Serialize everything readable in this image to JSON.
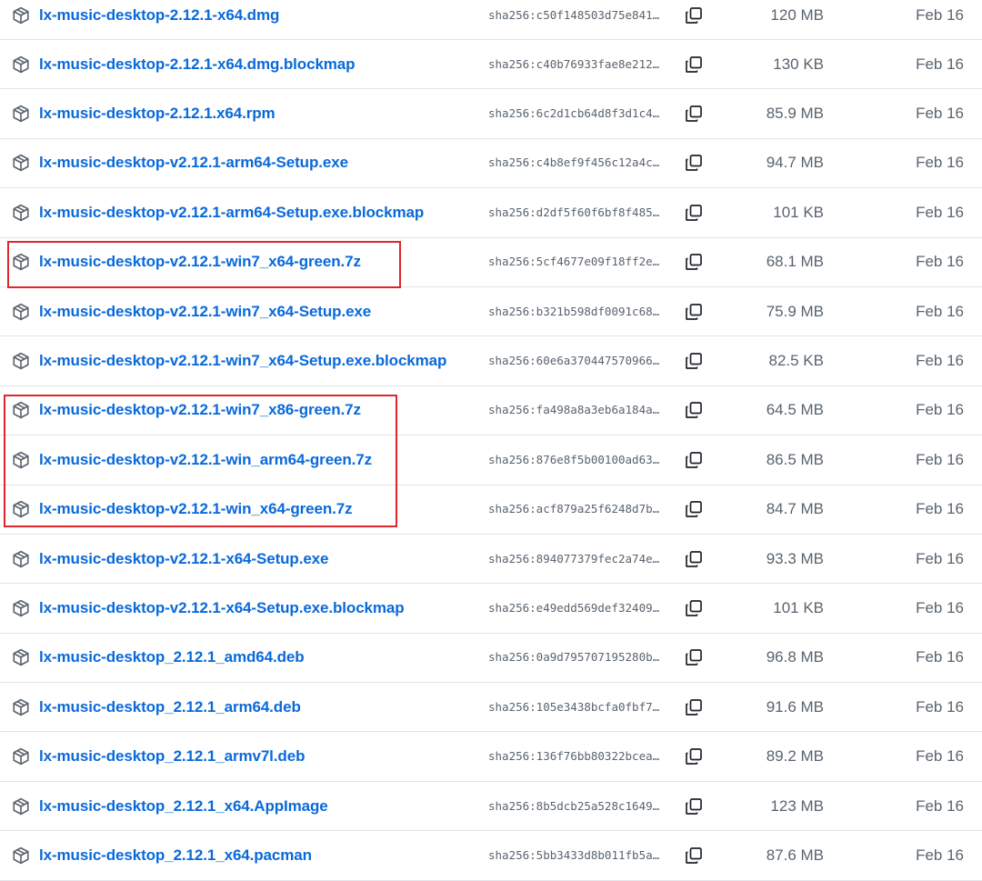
{
  "icons": {
    "package": "package-icon",
    "copy": "copy-icon"
  },
  "colors": {
    "link": "#0969da",
    "muted": "#59636e",
    "border": "#e1e4e8",
    "highlight": "#e0262d"
  },
  "assets": [
    {
      "name": "lx-music-desktop-2.12.1-x64.dmg",
      "sha": "sha256:c50f148503d75e841…",
      "size": "120 MB",
      "date": "Feb 16"
    },
    {
      "name": "lx-music-desktop-2.12.1-x64.dmg.blockmap",
      "sha": "sha256:c40b76933fae8e212…",
      "size": "130 KB",
      "date": "Feb 16"
    },
    {
      "name": "lx-music-desktop-2.12.1.x64.rpm",
      "sha": "sha256:6c2d1cb64d8f3d1c4…",
      "size": "85.9 MB",
      "date": "Feb 16"
    },
    {
      "name": "lx-music-desktop-v2.12.1-arm64-Setup.exe",
      "sha": "sha256:c4b8ef9f456c12a4c…",
      "size": "94.7 MB",
      "date": "Feb 16"
    },
    {
      "name": "lx-music-desktop-v2.12.1-arm64-Setup.exe.blockmap",
      "sha": "sha256:d2df5f60f6bf8f485…",
      "size": "101 KB",
      "date": "Feb 16"
    },
    {
      "name": "lx-music-desktop-v2.12.1-win7_x64-green.7z",
      "sha": "sha256:5cf4677e09f18ff2e…",
      "size": "68.1 MB",
      "date": "Feb 16"
    },
    {
      "name": "lx-music-desktop-v2.12.1-win7_x64-Setup.exe",
      "sha": "sha256:b321b598df0091c68…",
      "size": "75.9 MB",
      "date": "Feb 16"
    },
    {
      "name": "lx-music-desktop-v2.12.1-win7_x64-Setup.exe.blockmap",
      "sha": "sha256:60e6a370447570966…",
      "size": "82.5 KB",
      "date": "Feb 16"
    },
    {
      "name": "lx-music-desktop-v2.12.1-win7_x86-green.7z",
      "sha": "sha256:fa498a8a3eb6a184a…",
      "size": "64.5 MB",
      "date": "Feb 16"
    },
    {
      "name": "lx-music-desktop-v2.12.1-win_arm64-green.7z",
      "sha": "sha256:876e8f5b00100ad63…",
      "size": "86.5 MB",
      "date": "Feb 16"
    },
    {
      "name": "lx-music-desktop-v2.12.1-win_x64-green.7z",
      "sha": "sha256:acf879a25f6248d7b…",
      "size": "84.7 MB",
      "date": "Feb 16"
    },
    {
      "name": "lx-music-desktop-v2.12.1-x64-Setup.exe",
      "sha": "sha256:894077379fec2a74e…",
      "size": "93.3 MB",
      "date": "Feb 16"
    },
    {
      "name": "lx-music-desktop-v2.12.1-x64-Setup.exe.blockmap",
      "sha": "sha256:e49edd569def32409…",
      "size": "101 KB",
      "date": "Feb 16"
    },
    {
      "name": "lx-music-desktop_2.12.1_amd64.deb",
      "sha": "sha256:0a9d795707195280b…",
      "size": "96.8 MB",
      "date": "Feb 16"
    },
    {
      "name": "lx-music-desktop_2.12.1_arm64.deb",
      "sha": "sha256:105e3438bcfa0fbf7…",
      "size": "91.6 MB",
      "date": "Feb 16"
    },
    {
      "name": "lx-music-desktop_2.12.1_armv7l.deb",
      "sha": "sha256:136f76bb80322bcea…",
      "size": "89.2 MB",
      "date": "Feb 16"
    },
    {
      "name": "lx-music-desktop_2.12.1_x64.AppImage",
      "sha": "sha256:8b5dcb25a528c1649…",
      "size": "123 MB",
      "date": "Feb 16"
    },
    {
      "name": "lx-music-desktop_2.12.1_x64.pacman",
      "sha": "sha256:5bb3433d8b011fb5a…",
      "size": "87.6 MB",
      "date": "Feb 16"
    }
  ]
}
